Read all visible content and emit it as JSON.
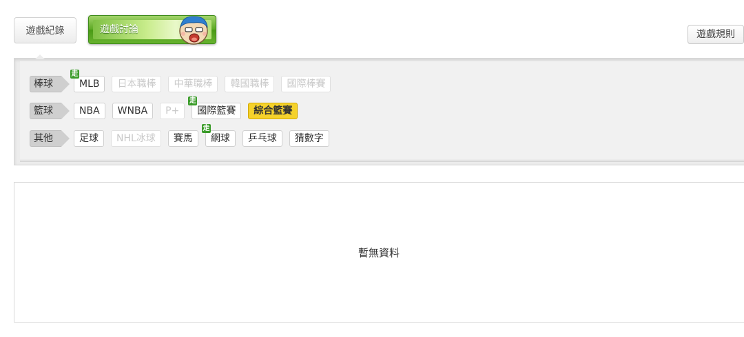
{
  "tabs": {
    "record": "遊戲紀錄",
    "discuss": "遊戲討論"
  },
  "rules_button": "遊戲規則",
  "live_badge": "走",
  "rows": [
    {
      "category": "棒球",
      "items": [
        {
          "label": "MLB",
          "state": "normal",
          "live": true
        },
        {
          "label": "日本職棒",
          "state": "disabled",
          "live": false
        },
        {
          "label": "中華職棒",
          "state": "disabled",
          "live": false
        },
        {
          "label": "韓國職棒",
          "state": "disabled",
          "live": false
        },
        {
          "label": "國際棒賽",
          "state": "disabled",
          "live": false
        }
      ]
    },
    {
      "category": "籃球",
      "items": [
        {
          "label": "NBA",
          "state": "normal",
          "live": false
        },
        {
          "label": "WNBA",
          "state": "normal",
          "live": false
        },
        {
          "label": "P+",
          "state": "disabled",
          "live": false
        },
        {
          "label": "國際籃賽",
          "state": "normal",
          "live": true
        },
        {
          "label": "綜合籃賽",
          "state": "active",
          "live": false
        }
      ]
    },
    {
      "category": "其他",
      "items": [
        {
          "label": "足球",
          "state": "normal",
          "live": false
        },
        {
          "label": "NHL冰球",
          "state": "disabled",
          "live": false
        },
        {
          "label": "賽馬",
          "state": "normal",
          "live": false
        },
        {
          "label": "網球",
          "state": "normal",
          "live": true
        },
        {
          "label": "乒乓球",
          "state": "normal",
          "live": false
        },
        {
          "label": "猜數字",
          "state": "normal",
          "live": false
        }
      ]
    }
  ],
  "empty_message": "暫無資料",
  "colors": {
    "active_chip": "#f5d22b",
    "live_badge": "#3b9c2a",
    "tab_green": "#5eaa25"
  }
}
